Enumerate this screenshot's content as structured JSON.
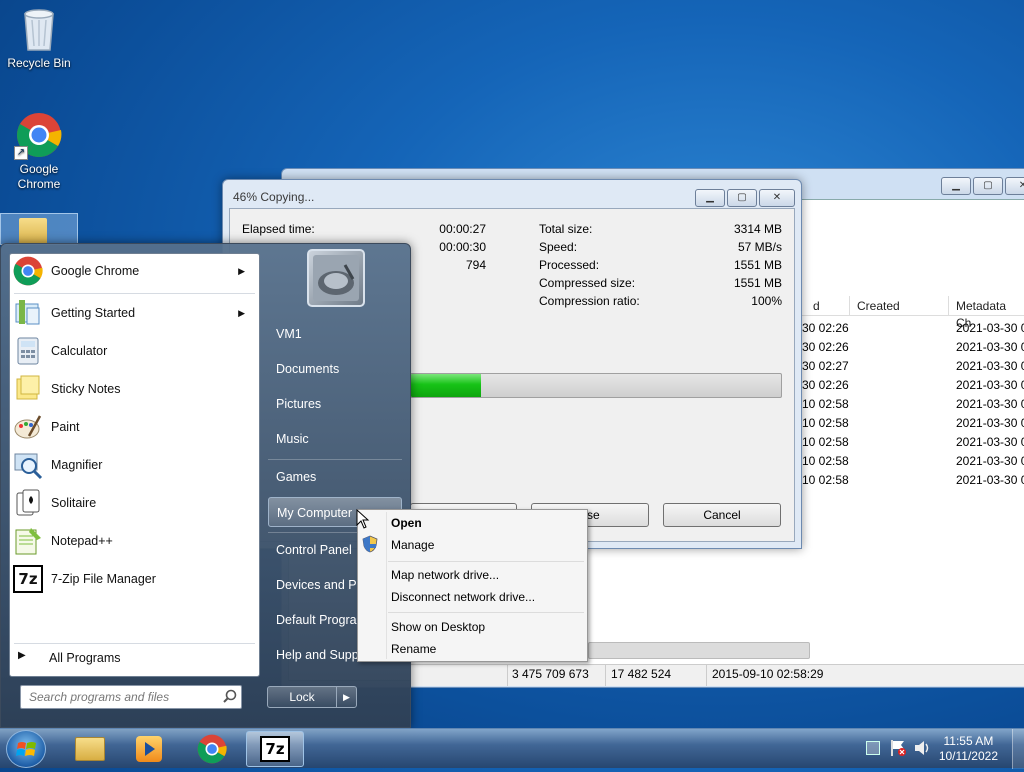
{
  "desktop": {
    "icons": [
      {
        "label": "Recycle Bin"
      },
      {
        "label": "Google Chrome"
      }
    ]
  },
  "explorer": {
    "columns": [
      "d",
      "Created",
      "Metadata Ch"
    ],
    "modified": [
      "30 02:26",
      "30 02:26",
      "30 02:27",
      "30 02:26",
      "10 02:58",
      "10 02:58",
      "10 02:58",
      "10 02:58",
      "10 02:58"
    ],
    "metadata": [
      "2021-03-30 0",
      "2021-03-30 0",
      "2021-03-30 0",
      "2021-03-30 0",
      "2021-03-30 0",
      "2021-03-30 0",
      "2021-03-30 0",
      "2021-03-30 0",
      "2021-03-30 0"
    ],
    "status": {
      "size": "3 475 709 673",
      "packed": "17 482 524",
      "modified": "2015-09-10 02:58:29"
    }
  },
  "copy_dialog": {
    "title": "46% Copying...",
    "left_labels": [
      "Elapsed time:"
    ],
    "left_values": [
      "00:00:27",
      "00:00:30",
      "794"
    ],
    "right_labels": [
      "Total size:",
      "Speed:",
      "Processed:",
      "Compressed size:",
      "Compression ratio:"
    ],
    "right_values": [
      "3314 MB",
      "57 MB/s",
      "1551 MB",
      "1551 MB",
      "100%"
    ],
    "progress": 0.46,
    "pause_label": "use",
    "cancel_label": "Cancel"
  },
  "start_menu": {
    "programs": [
      {
        "label": "Google Chrome",
        "icon": "chrome-icon",
        "has_submenu": true
      },
      {
        "label": "Getting Started",
        "icon": "getting-started-icon",
        "has_submenu": true
      },
      {
        "label": "Calculator",
        "icon": "calculator-icon",
        "has_submenu": false
      },
      {
        "label": "Sticky Notes",
        "icon": "sticky-notes-icon",
        "has_submenu": false
      },
      {
        "label": "Paint",
        "icon": "paint-icon",
        "has_submenu": false
      },
      {
        "label": "Magnifier",
        "icon": "magnifier-icon",
        "has_submenu": false
      },
      {
        "label": "Solitaire",
        "icon": "solitaire-icon",
        "has_submenu": false
      },
      {
        "label": "Notepad++",
        "icon": "notepad-plus-icon",
        "has_submenu": false
      },
      {
        "label": "7-Zip File Manager",
        "icon": "7zip-icon",
        "has_submenu": false
      }
    ],
    "all_programs": "All Programs",
    "search_placeholder": "Search programs and files",
    "right_items": [
      "VM1",
      "Documents",
      "Pictures",
      "Music",
      "Games",
      "My Computer",
      "Control Panel",
      "Devices and Pri",
      "Default Program",
      "Help and Supp"
    ],
    "selected_right_item": "My Computer",
    "lock_label": "Lock"
  },
  "context_menu": {
    "items": [
      "Open",
      "Manage",
      "Map network drive...",
      "Disconnect network drive...",
      "Show on Desktop",
      "Rename"
    ]
  },
  "taskbar": {
    "apps": [
      "explorer-icon",
      "media-player-icon",
      "chrome-icon",
      "7zip-icon"
    ],
    "time": "11:55 AM",
    "date": "10/11/2022"
  }
}
